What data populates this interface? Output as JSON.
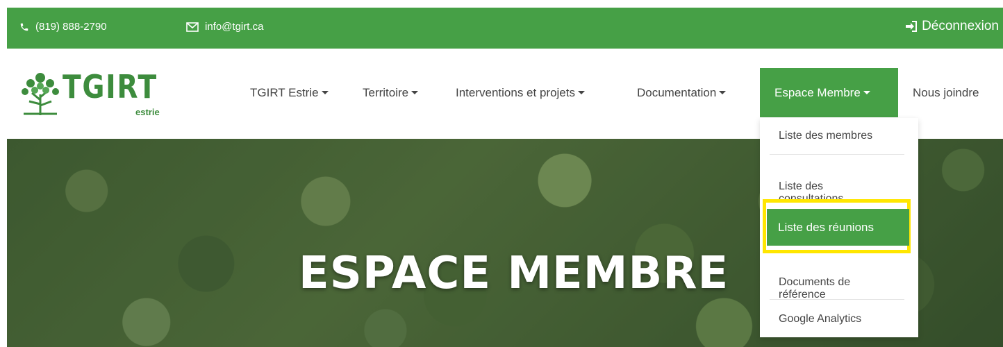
{
  "topbar": {
    "phone": "(819) 888-2790",
    "email": "info@tgirt.ca",
    "logout": "Déconnexion",
    "bg_color": "#46a046"
  },
  "logo": {
    "name": "TGIRT",
    "subtitle": "estrie"
  },
  "nav": {
    "items": [
      {
        "label": "TGIRT Estrie"
      },
      {
        "label": "Territoire"
      },
      {
        "label": "Interventions et projets"
      },
      {
        "label": "Documentation"
      },
      {
        "label": "Espace Membre",
        "active": true
      },
      {
        "label": "Nous joindre"
      }
    ]
  },
  "hero": {
    "title": "ESPACE MEMBRE"
  },
  "dropdown": {
    "items": [
      {
        "label": "Liste des membres"
      },
      {
        "label": "Liste des\nconsultations"
      },
      {
        "label": "Liste des réunions",
        "active": true,
        "highlighted": true
      },
      {
        "label": "Documents de\nréférence"
      },
      {
        "label": "Google Analytics"
      }
    ]
  },
  "colors": {
    "accent": "#46a046",
    "highlight": "#ffe600"
  }
}
